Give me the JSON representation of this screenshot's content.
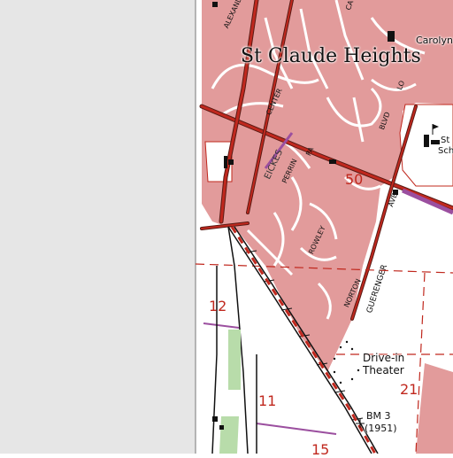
{
  "map": {
    "place_name": "St Claude Heights",
    "feature_labels": {
      "drive_in_line1": "Drive-in",
      "drive_in_line2": "Theater",
      "benchmark_line1": "BM 3",
      "benchmark_line2": "(1951)",
      "school_partial_line1": "St",
      "school_partial_line2": "Sch",
      "carolyn_partial": "Carolyn"
    },
    "street_labels": {
      "alexander": "ALEXANDER",
      "center": "CENTER",
      "eckes": "EICKES",
      "perrin": "PERRIN",
      "blvd": "BLVD",
      "ave": "AVE",
      "rowley": "ROWLEY",
      "norton": "NORTON",
      "guerenger": "GUERENGER",
      "ca_partial": "CA",
      "pa_partial": "PA",
      "lo_partial": "LO"
    },
    "section_numbers": {
      "s50": "50",
      "s12": "12",
      "s11": "11",
      "s21": "21",
      "s15_partial": "15"
    },
    "colors": {
      "urban_tint": "#e29b9b",
      "road_red": "#c0281e",
      "road_casing": "#5a1a14",
      "water_grey": "#e6e6e6",
      "vegetation": "#b8dcaa",
      "purple_highway": "#9b4f9f",
      "building_black": "#111111",
      "background": "#ffffff"
    }
  }
}
